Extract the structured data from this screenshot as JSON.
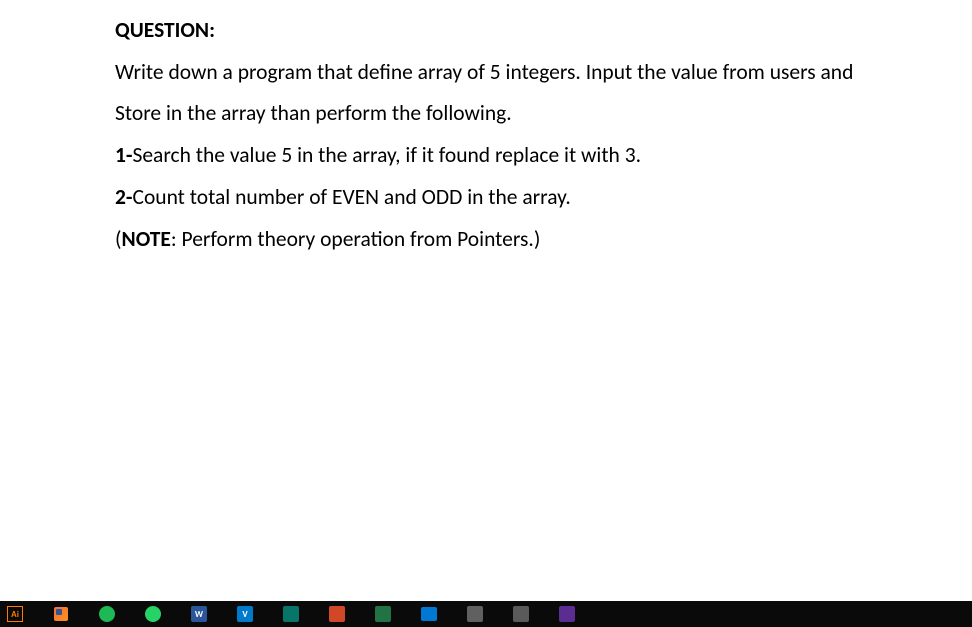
{
  "document": {
    "heading": "QUESTION:",
    "line1": "Write down a program that define array of 5 integers. Input the value from users and",
    "line2": "Store in the array than perform the following.",
    "item1_prefix": "1-",
    "item1_text": "Search the value 5 in the array, if it found replace it with 3.",
    "item2_prefix": "2-",
    "item2_text": "Count total number of EVEN and ODD in the array.",
    "note_prefix": "(",
    "note_bold": "NOTE",
    "note_text": ": Perform theory operation from Pointers.)"
  },
  "taskbar": {
    "icons": {
      "ai": "Ai",
      "word": "W",
      "vscode": "V"
    }
  }
}
